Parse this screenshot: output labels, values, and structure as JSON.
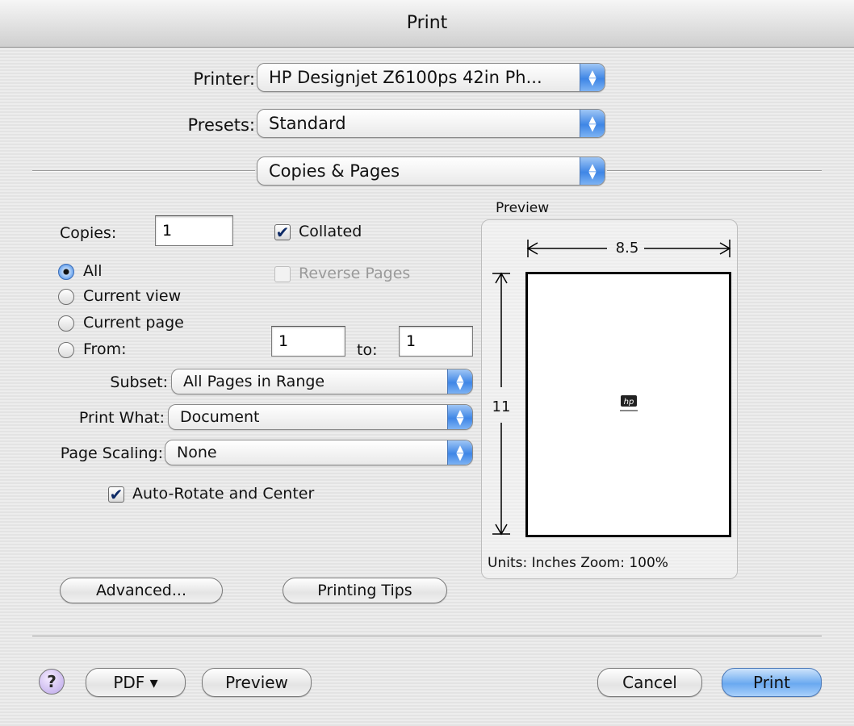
{
  "window": {
    "title": "Print"
  },
  "printer": {
    "label": "Printer:",
    "value": "HP Designjet Z6100ps 42in Ph..."
  },
  "presets": {
    "label": "Presets:",
    "value": "Standard"
  },
  "panel": {
    "value": "Copies & Pages"
  },
  "copies": {
    "label": "Copies:",
    "value": "1",
    "collated_label": "Collated",
    "collated_checked": true,
    "reverse_label": "Reverse Pages",
    "reverse_checked": false
  },
  "range": {
    "all_label": "All",
    "current_view_label": "Current view",
    "current_page_label": "Current page",
    "from_label": "From:",
    "from_value": "1",
    "to_label": "to:",
    "to_value": "1",
    "selected": "All"
  },
  "subset": {
    "label": "Subset:",
    "value": "All Pages in Range"
  },
  "print_what": {
    "label": "Print What:",
    "value": "Document"
  },
  "page_scaling": {
    "label": "Page Scaling:",
    "value": "None"
  },
  "auto_rotate": {
    "label": "Auto-Rotate and Center",
    "checked": true
  },
  "preview": {
    "title": "Preview",
    "width_label": "8.5",
    "height_label": "11",
    "footer": "Units: Inches Zoom: 100%"
  },
  "buttons": {
    "advanced": "Advanced...",
    "printing_tips": "Printing Tips",
    "help": "?",
    "pdf": "PDF ▾",
    "preview": "Preview",
    "cancel": "Cancel",
    "print": "Print"
  },
  "icons": {
    "popup_arrows": "up-down-arrows-icon",
    "check": "checkmark-icon",
    "logo": "hp-logo-icon"
  },
  "colors": {
    "accent": "#4a8ee8",
    "default_button": "#6aa9f0"
  }
}
